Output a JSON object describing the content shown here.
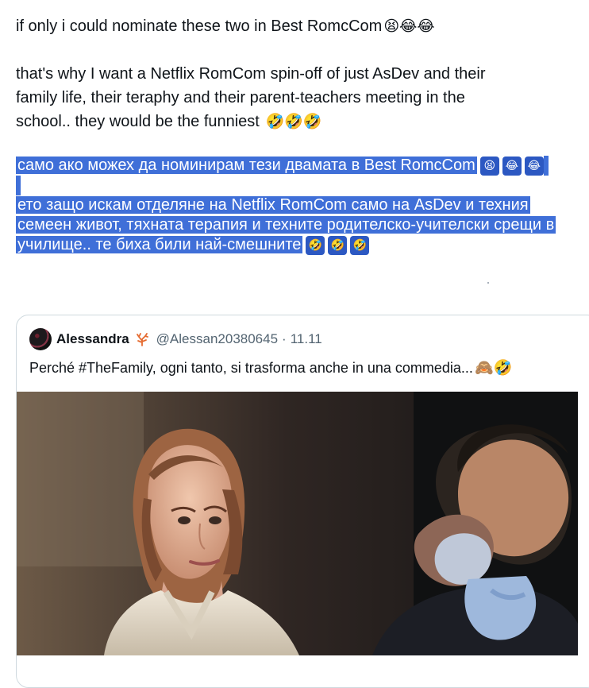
{
  "post": {
    "line1": "if only i could nominate these two in Best RomcCom",
    "line1_emojis": "😫😂😂",
    "para2_line1": "that's why I want a Netflix RomCom spin-off of just AsDev and their",
    "para2_line2": "family life, their teraphy and their parent-teachers meeting in the",
    "para2_line3": "school.. they would be the funniest",
    "para2_emojis": "🤣🤣🤣"
  },
  "translation": {
    "line1": "само ако можех да номинирам тези двамата в Best RomcCom",
    "line1_emojis": [
      "😫",
      "😂",
      "😂"
    ],
    "line2": "ето защо искам отделяне на Netflix RomCom само на AsDev и техния",
    "line3": "семеен живот, тяхната терапия и техните родителско-учителски срещи в",
    "line4": "училище.. те биха били най-смешните",
    "line4_emojis": [
      "🤣",
      "🤣",
      "🤣"
    ]
  },
  "quote": {
    "name": "Alessandra",
    "badge_icon": "coral-icon",
    "handle": "@Alessan20380645",
    "separator": "·",
    "date": "11.11",
    "text": "Perché #TheFamily, ogni tanto, si trasforma anche in una commedia...",
    "text_emojis": "🙈🤣"
  },
  "colors": {
    "highlight": "#3f6fd8",
    "text": "#0f1419",
    "muted": "#536471",
    "border": "#cfd9de"
  }
}
